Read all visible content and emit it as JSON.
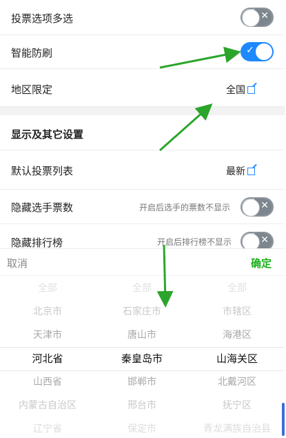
{
  "settings": {
    "multi_select_label": "投票选项多选",
    "anti_spam_label": "智能防刷",
    "region_label": "地区限定",
    "region_value": "全国",
    "section_title": "显示及其它设置",
    "default_list_label": "默认投票列表",
    "default_list_value": "最新",
    "hide_votes_label": "隐藏选手票数",
    "hide_votes_hint": "开启后选手的票数不显示",
    "hide_rank_label": "隐藏排行榜",
    "hide_rank_hint": "开启后排行榜不显示"
  },
  "toggles": {
    "multi_select": false,
    "anti_spam": true,
    "hide_votes": false,
    "hide_rank": false
  },
  "icons": {
    "off_mark": "✕",
    "on_mark": "✓"
  },
  "picker": {
    "cancel_label": "取消",
    "confirm_label": "确定",
    "province": [
      "全部",
      "北京市",
      "天津市",
      "河北省",
      "山西省",
      "内蒙古自治区",
      "辽宁省"
    ],
    "city": [
      "全部",
      "石家庄市",
      "唐山市",
      "秦皇岛市",
      "邯郸市",
      "邢台市",
      "保定市"
    ],
    "district": [
      "全部",
      "市辖区",
      "海港区",
      "山海关区",
      "北戴河区",
      "抚宁区",
      "青龙满族自治县"
    ]
  },
  "colors": {
    "accent": "#1e88ff",
    "confirm": "#1aad19",
    "arrow": "#2ba52b"
  }
}
